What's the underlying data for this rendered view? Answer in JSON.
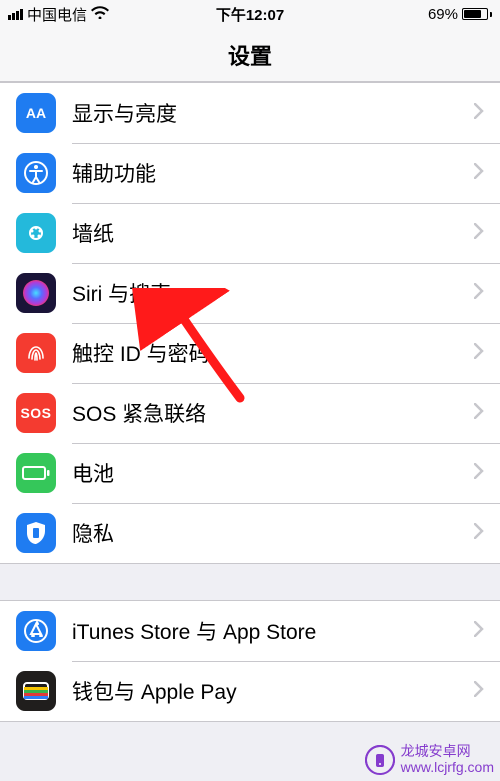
{
  "status": {
    "carrier": "中国电信",
    "time": "下午12:07",
    "battery_pct": "69%",
    "battery_fill_pct": 69
  },
  "nav": {
    "title": "设置"
  },
  "group1": {
    "items": [
      {
        "label": "显示与亮度"
      },
      {
        "label": "辅助功能"
      },
      {
        "label": "墙纸"
      },
      {
        "label": "Siri 与搜索"
      },
      {
        "label": "触控 ID 与密码"
      },
      {
        "label": "SOS 紧急联络"
      },
      {
        "label": "电池"
      },
      {
        "label": "隐私"
      }
    ]
  },
  "group2": {
    "items": [
      {
        "label": "iTunes Store 与 App Store"
      },
      {
        "label": "钱包与 Apple Pay"
      }
    ]
  },
  "sos_icon_text": "SOS",
  "watermark": {
    "line1": "龙城安卓网",
    "line2": "www.lcjrfg.com"
  }
}
